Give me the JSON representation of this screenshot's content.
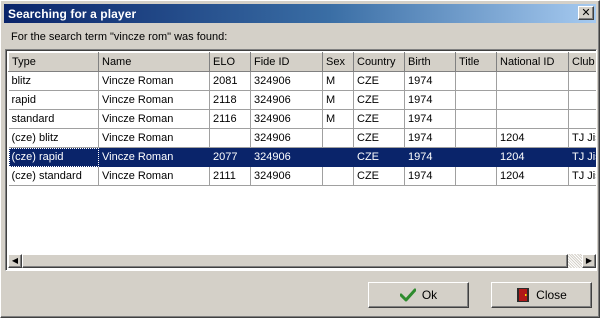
{
  "window": {
    "title": "Searching for a player",
    "close_glyph": "✕"
  },
  "subtitle": "For the search term \"vincze rom\" was found:",
  "table": {
    "columns": [
      "Type",
      "Name",
      "ELO",
      "Fide ID",
      "Sex",
      "Country",
      "Birth",
      "Title",
      "National ID",
      "Club"
    ],
    "rows": [
      [
        "blitz",
        "Vincze Roman",
        "2081",
        "324906",
        "M",
        "CZE",
        "1974",
        "",
        "",
        ""
      ],
      [
        "rapid",
        "Vincze Roman",
        "2118",
        "324906",
        "M",
        "CZE",
        "1974",
        "",
        "",
        ""
      ],
      [
        "standard",
        "Vincze Roman",
        "2116",
        "324906",
        "M",
        "CZE",
        "1974",
        "",
        "",
        ""
      ],
      [
        "(cze) blitz",
        "Vincze Roman",
        "",
        "324906",
        "",
        "CZE",
        "1974",
        "",
        "1204",
        "TJ Jisk"
      ],
      [
        "(cze) rapid",
        "Vincze Roman",
        "2077",
        "324906",
        "",
        "CZE",
        "1974",
        "",
        "1204",
        "TJ Jisk"
      ],
      [
        "(cze) standard",
        "Vincze Roman",
        "2111",
        "324906",
        "",
        "CZE",
        "1974",
        "",
        "1204",
        "TJ Jisk"
      ]
    ],
    "selected_row": 4
  },
  "scrollbar": {
    "left_arrow": "◀",
    "right_arrow": "▶"
  },
  "buttons": {
    "ok_label": "Ok",
    "ok_icon": "checkmark-icon",
    "close_label": "Close",
    "close_icon": "door-exit-icon"
  },
  "colors": {
    "selection": "#0a246a",
    "titlebar_start": "#0a246a",
    "titlebar_end": "#a6caf0",
    "check_green": "#2e8b2e",
    "door_red": "#b01818"
  }
}
